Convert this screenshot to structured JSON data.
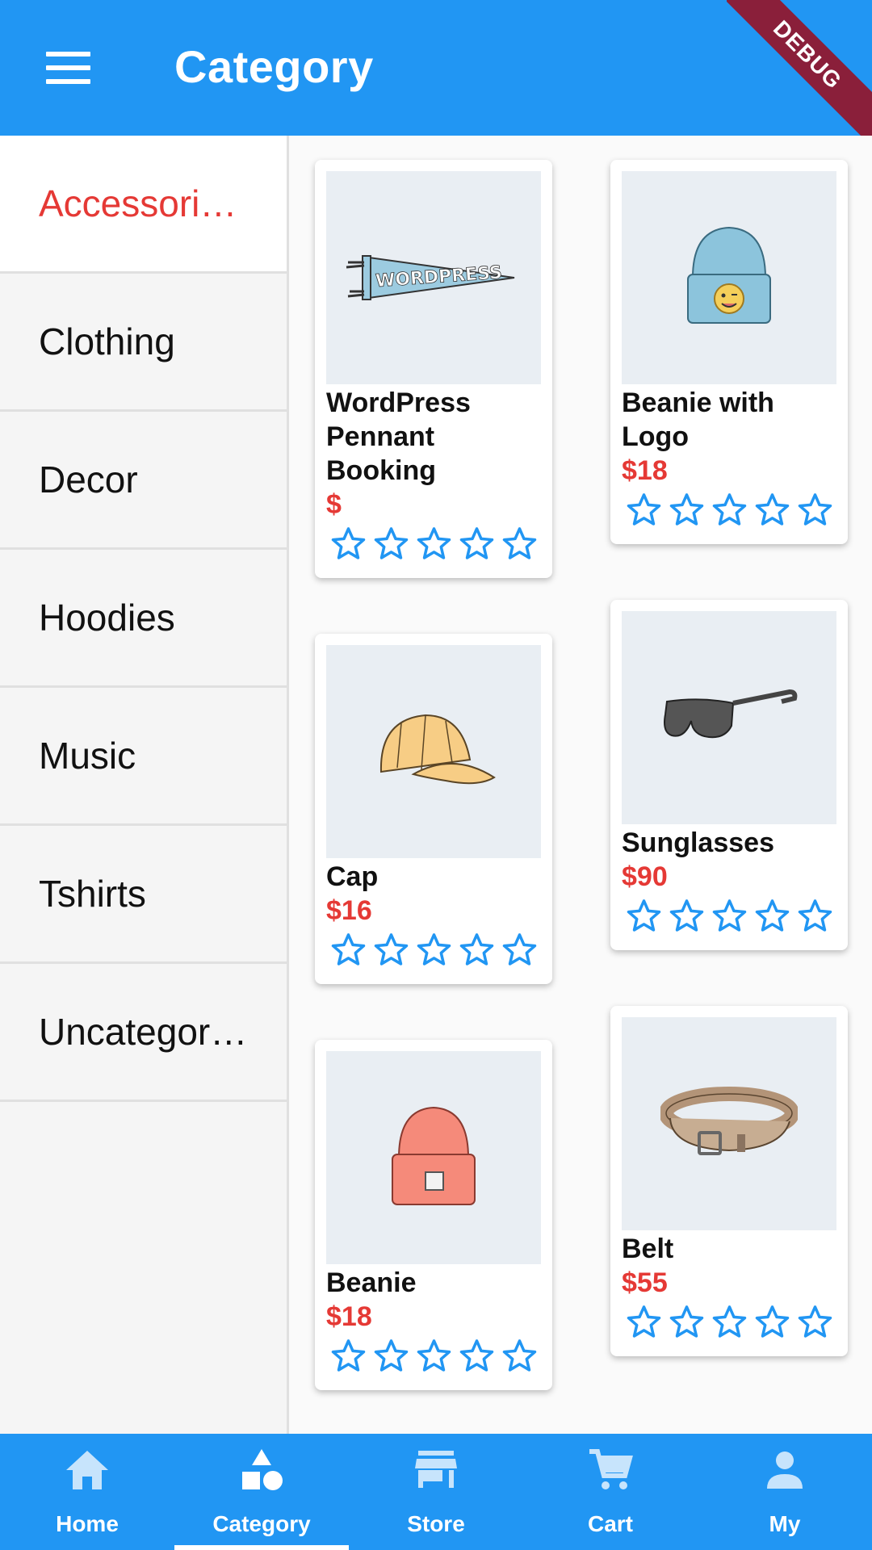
{
  "appbar": {
    "title": "Category",
    "debug_label": "DEBUG"
  },
  "sidebar": {
    "items": [
      {
        "label": "Accessori…",
        "active": true
      },
      {
        "label": "Clothing"
      },
      {
        "label": "Decor"
      },
      {
        "label": "Hoodies"
      },
      {
        "label": "Music"
      },
      {
        "label": "Tshirts"
      },
      {
        "label": "Uncategor…"
      }
    ]
  },
  "products": [
    {
      "name": "WordPress Pennant Booking",
      "price": "$",
      "image": "pennant-image",
      "rating": 0
    },
    {
      "name": "Beanie with Logo",
      "price": "$18",
      "image": "beanie-logo-image",
      "rating": 0
    },
    {
      "name": "Cap",
      "price": "$16",
      "image": "cap-image",
      "rating": 0
    },
    {
      "name": "Sunglasses",
      "price": "$90",
      "image": "sunglasses-image",
      "rating": 0
    },
    {
      "name": "Beanie",
      "price": "$18",
      "image": "beanie-image",
      "rating": 0
    },
    {
      "name": "Belt",
      "price": "$55",
      "image": "belt-image",
      "rating": 0
    }
  ],
  "pennant_text": "WORDPRESS",
  "bottom_nav": [
    {
      "label": "Home",
      "icon": "home-icon"
    },
    {
      "label": "Category",
      "icon": "category-icon",
      "active": true
    },
    {
      "label": "Store",
      "icon": "store-icon"
    },
    {
      "label": "Cart",
      "icon": "cart-icon"
    },
    {
      "label": "My",
      "icon": "person-icon"
    }
  ],
  "colors": {
    "primary": "#2196f3",
    "accent": "#e53935",
    "ribbon": "#8a1f3a"
  }
}
